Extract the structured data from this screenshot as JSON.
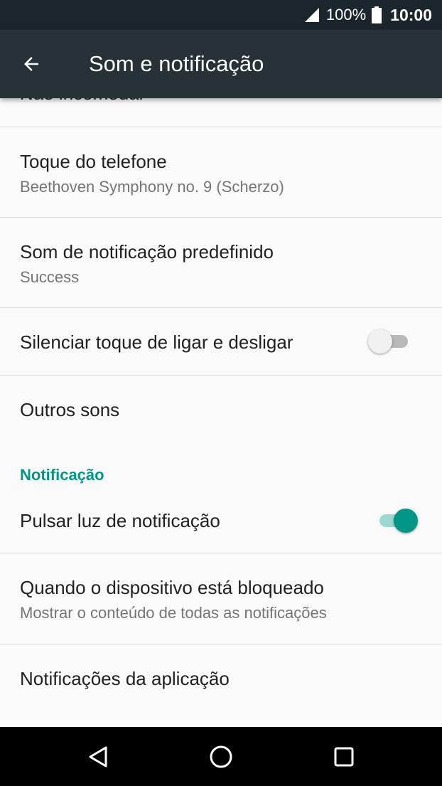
{
  "status_bar": {
    "battery_percent": "100%",
    "time": "10:00",
    "icons": [
      "signal-icon",
      "battery-icon"
    ]
  },
  "app_bar": {
    "title": "Som e notificação",
    "back_icon": "arrow-left-icon"
  },
  "settings": {
    "partial_item": "Não incomodar",
    "ringtone": {
      "title": "Toque do telefone",
      "summary": "Beethoven Symphony no. 9 (Scherzo)"
    },
    "notification_sound": {
      "title": "Som de notificação predefinido",
      "summary": "Success"
    },
    "power_sounds": {
      "title": "Silenciar toque de ligar e desligar",
      "enabled": false
    },
    "other_sounds": {
      "title": "Outros sons"
    },
    "notification_category": "Notificação",
    "pulse_light": {
      "title": "Pulsar luz de notificação",
      "enabled": true
    },
    "lock_screen": {
      "title": "Quando o dispositivo está bloqueado",
      "summary": "Mostrar o conteúdo de todas as notificações"
    },
    "app_notifications": {
      "title": "Notificações da aplicação"
    }
  },
  "colors": {
    "accent": "#009688",
    "app_bar": "#263238",
    "status_bar": "#1b262c"
  },
  "nav_bar": {
    "icons": [
      "back-triangle-icon",
      "home-circle-icon",
      "recents-square-icon"
    ]
  }
}
